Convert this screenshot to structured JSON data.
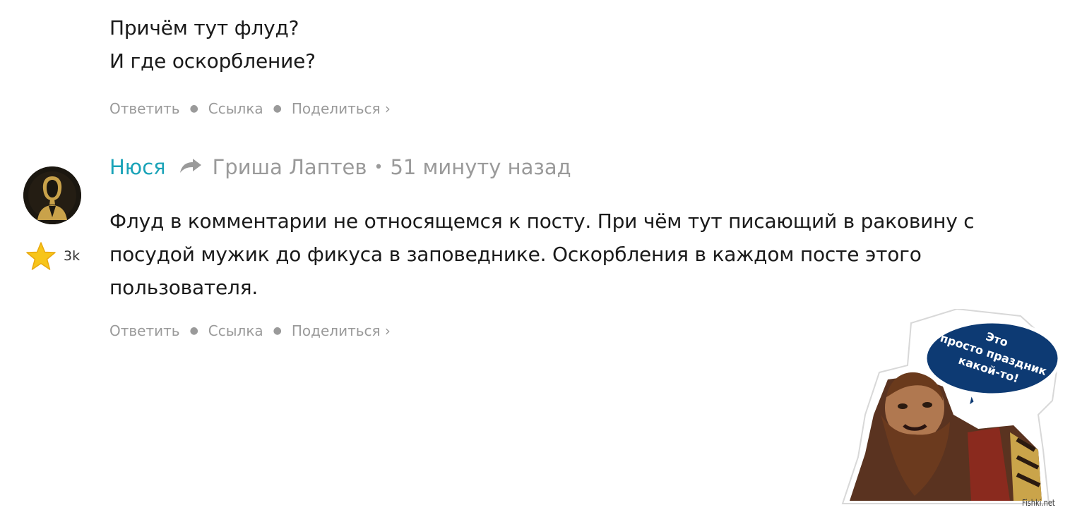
{
  "comment1": {
    "lines": [
      "Причём тут флуд?",
      "И где оскорбление?"
    ],
    "actions": {
      "reply": "Ответить",
      "link": "Ссылка",
      "share": "Поделиться ›"
    }
  },
  "comment2": {
    "author": "Нюся",
    "reply_to": "Гриша Лаптев",
    "separator": "•",
    "time": "51 минуту назад",
    "rating": "3k",
    "lines": [
      "Флуд в комментарии не относящемся к посту. При чём тут писающий в раковину с",
      "посудой мужик до фикуса в заповеднике. Оскорбления в каждом посте этого",
      "пользователя."
    ],
    "actions": {
      "reply": "Ответить",
      "link": "Ссылка",
      "share": "Поделиться ›"
    }
  },
  "sticker": {
    "bubble_lines": [
      "Это",
      "просто праздник",
      "какой-то!"
    ]
  },
  "watermark": "Fishki.net",
  "colors": {
    "author": "#1aa3b8",
    "muted": "#9a9a9a",
    "text": "#1a1a1a",
    "star": "#f7c51a"
  },
  "icons": {
    "reply": "reply-arrow-icon",
    "rating": "star-icon"
  }
}
